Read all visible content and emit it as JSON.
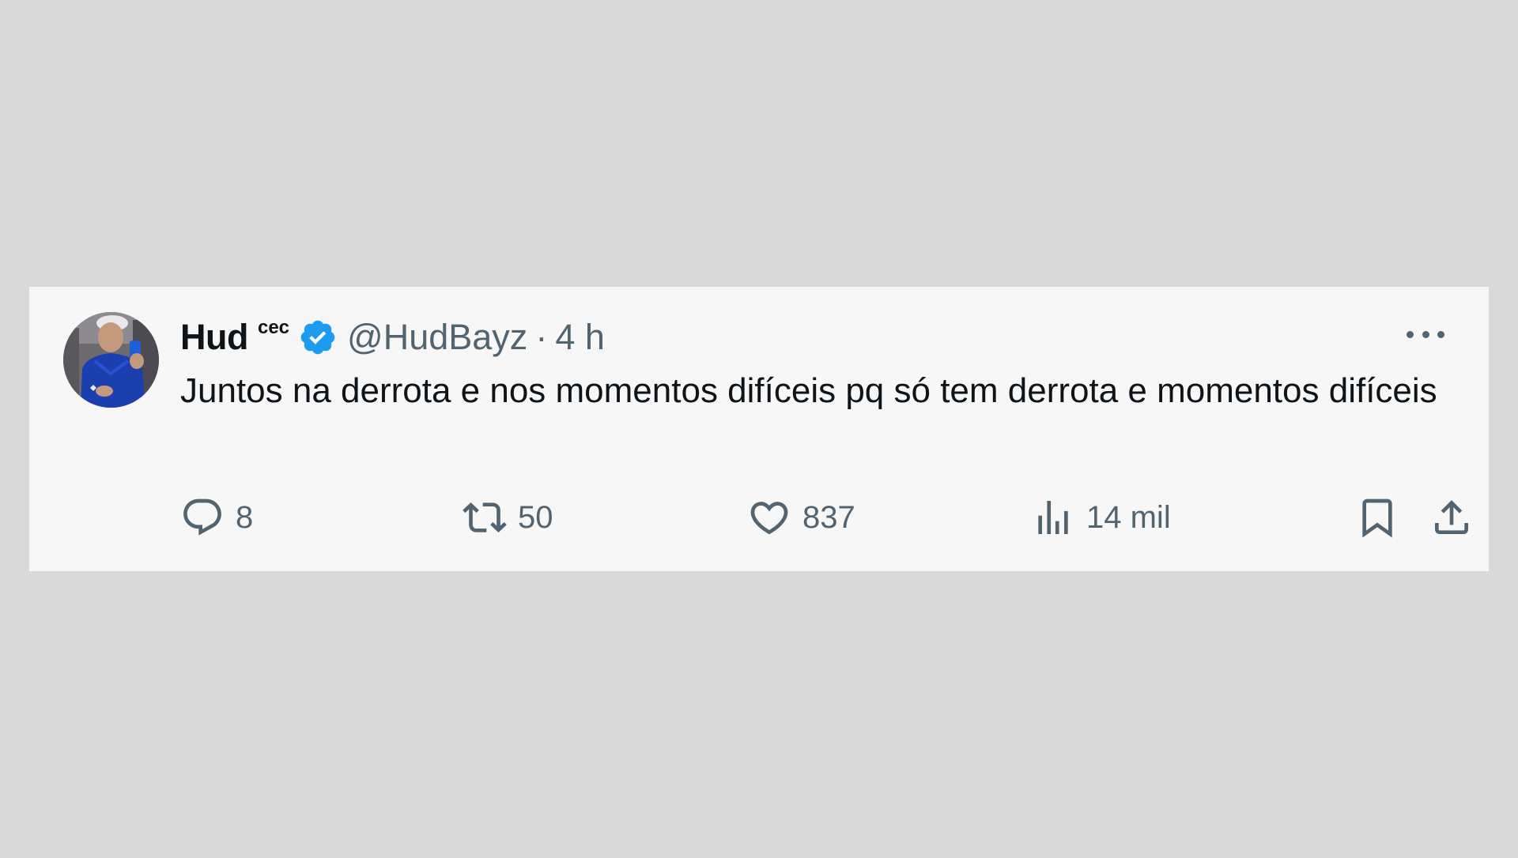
{
  "tweet": {
    "display_name": "Hud",
    "name_suffix": "cec",
    "handle": "@HudBayz",
    "separator": "·",
    "timestamp": "4 h",
    "text": "Juntos na derrota e nos momentos difíceis pq só tem derrota e momentos difíceis"
  },
  "actions": {
    "replies": "8",
    "reposts": "50",
    "likes": "837",
    "views": "14 mil"
  },
  "icons": {
    "verified": "verified-badge-icon",
    "more": "more-icon",
    "reply": "reply-icon",
    "repost": "repost-icon",
    "like": "heart-icon",
    "views": "views-chart-icon",
    "bookmark": "bookmark-icon",
    "share": "share-icon"
  },
  "colors": {
    "background": "#d9d9d9",
    "card": "#f7f7f7",
    "text": "#0f1419",
    "secondary": "#536471",
    "verified": "#1d9bf0"
  }
}
